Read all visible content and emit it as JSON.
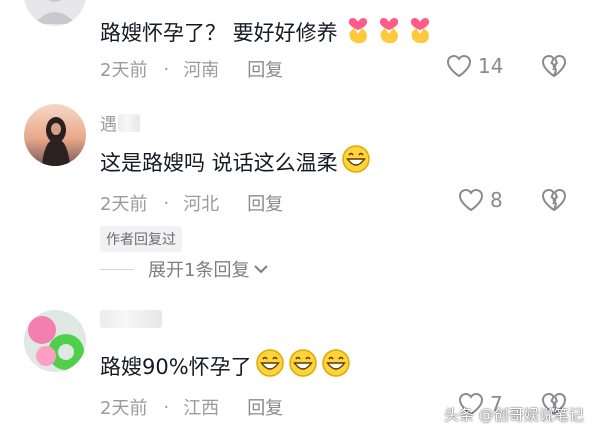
{
  "comments": [
    {
      "username": "",
      "text": "路嫂怀孕了？ 要好好修养",
      "emojis": [
        "heart-hands-icon",
        "heart-hands-icon",
        "heart-hands-icon"
      ],
      "time": "2天前",
      "location": "河南",
      "reply_label": "回复",
      "likes": "14"
    },
    {
      "username": "遇",
      "text": "这是路嫂吗 说话这么温柔",
      "emojis": [
        "grinning-face-icon"
      ],
      "time": "2天前",
      "location": "河北",
      "reply_label": "回复",
      "likes": "8",
      "author_tag": "作者回复过",
      "expand_label": "展开1条回复"
    },
    {
      "username": "",
      "text": "路嫂90%怀孕了",
      "emojis": [
        "grinning-face-icon",
        "grinning-face-icon",
        "grinning-face-icon"
      ],
      "time": "2天前",
      "location": "江西",
      "reply_label": "回复",
      "likes": "7"
    }
  ],
  "separator": "·",
  "watermark": "头条 @创哥娱说笔记",
  "colors": {
    "text": "#161823",
    "meta": "#9a9aa0",
    "tag_bg": "#f2f2f4",
    "emoji_yellow": "#ffd43b",
    "heart_pink": "#ff5c8a"
  }
}
